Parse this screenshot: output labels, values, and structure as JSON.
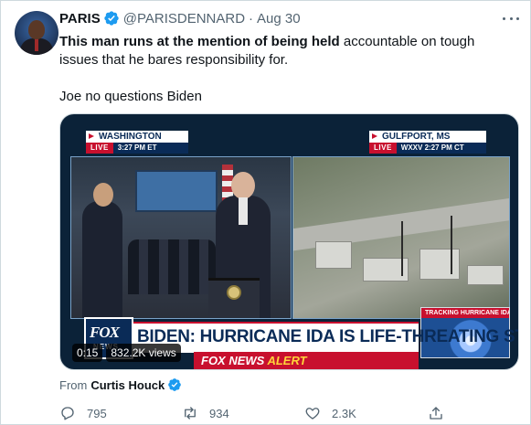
{
  "tweet": {
    "author": {
      "display_name": "PARIS",
      "handle": "@PARISDENNARD",
      "separator": "·",
      "date": "Aug 30",
      "verified": true
    },
    "text": {
      "line1_bold": "This man runs at the mention of being held",
      "line1_rest": " accountable on tough issues that he bares responsibility for.",
      "line2": "Joe no questions Biden"
    },
    "media": {
      "left_location": "WASHINGTON",
      "left_live": "LIVE",
      "left_time": "3:27 PM ET",
      "right_location": "GULFPORT, MS",
      "right_live": "LIVE",
      "right_time": "WXXV   2:27 PM CT",
      "tracking_label": "TRACKING HURRICANE IDA",
      "headline": "BIDEN: HURRICANE IDA IS LIFE-THREATING STORM",
      "logo_main": "FOX",
      "logo_sub": "NEWS",
      "alert_prefix": "FOX NEWS",
      "alert_suffix": " ALERT",
      "duration": "0:15",
      "views": "832.2K views"
    },
    "source": {
      "prefix": "From",
      "name": "Curtis Houck",
      "verified": true
    },
    "actions": {
      "replies": "795",
      "retweets": "934",
      "likes": "2.3K"
    },
    "icons": {
      "verified": "verified-badge-icon",
      "more": "more-icon",
      "reply": "reply-icon",
      "retweet": "retweet-icon",
      "like": "heart-icon",
      "share": "share-icon"
    },
    "colors": {
      "verified_blue": "#1d9bf0",
      "secondary_text": "#536471",
      "fox_red": "#c8102e",
      "fox_navy": "#0a2b57"
    }
  }
}
